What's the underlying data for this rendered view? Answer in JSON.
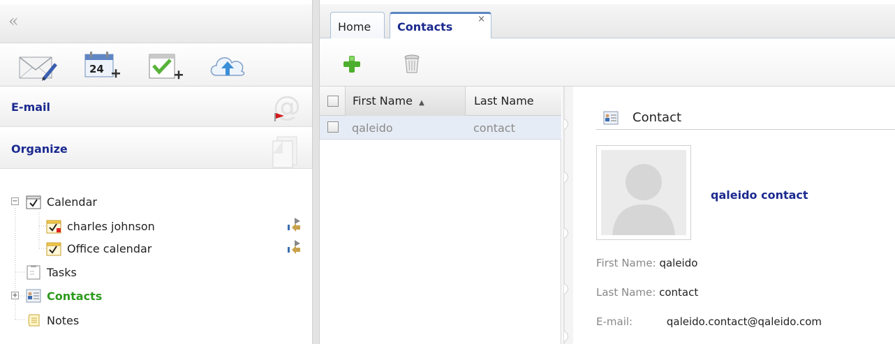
{
  "left_panel": {
    "collapse_label": "«",
    "sections": {
      "email": "E-mail",
      "organize": "Organize"
    },
    "tree": {
      "calendar": "Calendar",
      "charles_johnson": "charles johnson",
      "office_calendar": "Office calendar",
      "tasks": "Tasks",
      "contacts": "Contacts",
      "notes": "Notes"
    }
  },
  "tabs": [
    {
      "label": "Home"
    },
    {
      "label": "Contacts",
      "close": "×"
    }
  ],
  "grid": {
    "columns": [
      "First Name",
      "Last Name"
    ],
    "sort_indicator": "▲",
    "rows": [
      {
        "first_name": "qaleido",
        "last_name": "contact"
      }
    ]
  },
  "detail": {
    "header": "Contact",
    "full_name": "qaleido contact",
    "fields": {
      "first_name": {
        "label": "First Name:",
        "value": "qaleido"
      },
      "last_name": {
        "label": "Last Name:",
        "value": "contact"
      },
      "email": {
        "label": "E-mail:",
        "value": "qaleido.contact@qaleido.com"
      }
    }
  },
  "colors": {
    "link_blue": "#1b2a8f",
    "contacts_green": "#2e9a1f",
    "selected_row": "#e6ecf5"
  }
}
